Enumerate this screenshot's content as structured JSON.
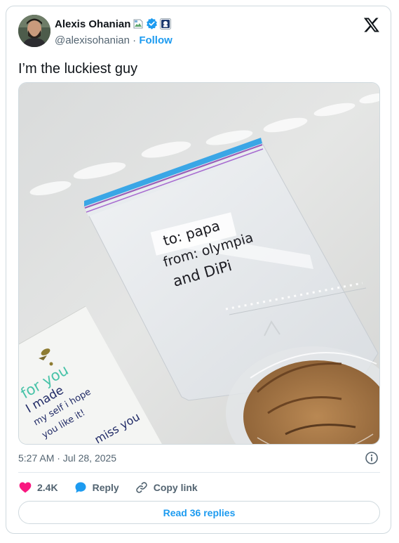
{
  "author": {
    "name": "Alexis Ohanian",
    "handle": "@alexisohanian",
    "separator": " · ",
    "follow_label": "Follow"
  },
  "badges": [
    "broken-image-icon",
    "verified-icon",
    "affiliate-badge-icon"
  ],
  "tweet": {
    "text": "I’m the luckiest guy",
    "image_handwriting": {
      "bag_note": [
        "to: papa",
        "from: olympia",
        "and DiPi"
      ],
      "card_note": [
        "for you",
        "I made",
        "my self i hope",
        "you like it!",
        "miss you"
      ]
    }
  },
  "meta": {
    "timestamp": "5:27 AM · Jul 28, 2025"
  },
  "actions": {
    "likes": "2.4K",
    "reply_label": "Reply",
    "copy_link_label": "Copy link"
  },
  "read_replies_label": "Read 36 replies",
  "colors": {
    "accent": "#1d9bf0",
    "like": "#f91880",
    "muted": "#536471",
    "text": "#0f1419"
  }
}
